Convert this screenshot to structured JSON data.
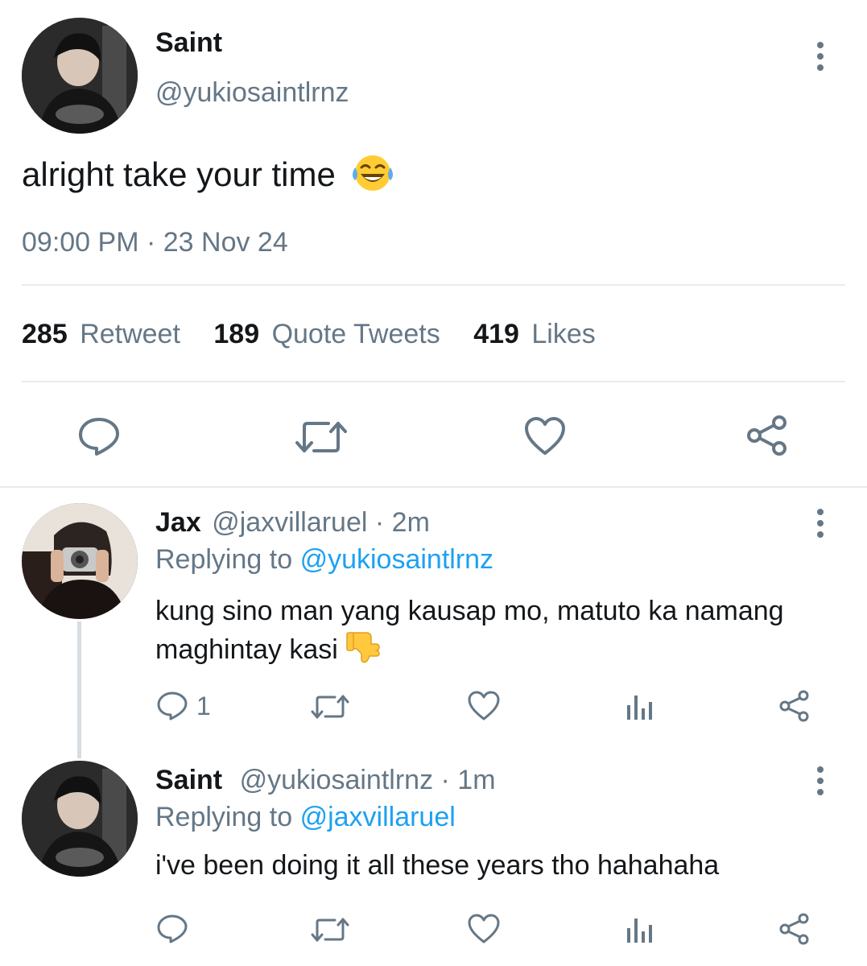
{
  "main_tweet": {
    "display_name": "Saint",
    "handle": "@yukiosaintlrnz",
    "text": "alright take your time",
    "emoji": "joy-emoji",
    "timestamp": "09:00 PM · 23 Nov 24",
    "stats": {
      "retweets_count": "285",
      "retweets_label": "Retweet",
      "quotes_count": "189",
      "quotes_label": "Quote Tweets",
      "likes_count": "419",
      "likes_label": "Likes"
    },
    "actions": [
      "reply-icon",
      "retweet-icon",
      "like-icon",
      "share-icon"
    ]
  },
  "replies": [
    {
      "display_name": "Jax",
      "handle": "@jaxvillaruel",
      "time": "· 2m",
      "replying_prefix": "Replying to",
      "replying_to": "@yukiosaintlrnz",
      "text_line1": "kung sino man yang kausap mo, matuto ka namang",
      "text_line2": "maghintay kasi",
      "emoji": "thumbs-down-emoji",
      "reply_count": "1"
    },
    {
      "display_name": "Saint",
      "handle": "@yukiosaintlrnz",
      "time": "· 1m",
      "replying_prefix": "Replying to",
      "replying_to": "@jaxvillaruel",
      "text": "i've been doing it all these years tho hahahaha",
      "reply_count": ""
    }
  ],
  "colors": {
    "text": "#14171a",
    "secondary": "#657786",
    "link": "#1da1f2",
    "divider": "#e6ecf0"
  }
}
